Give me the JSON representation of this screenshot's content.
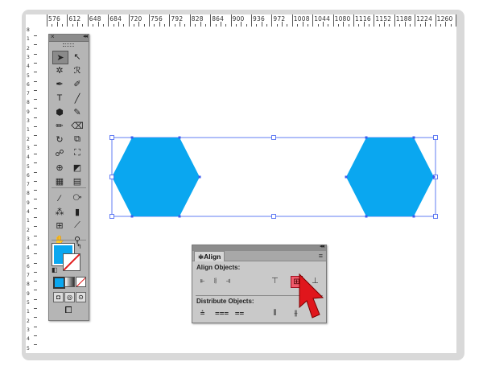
{
  "ruler": {
    "top_numbers": [
      "576",
      "612",
      "648",
      "684",
      "720",
      "756",
      "792",
      "828",
      "864",
      "900",
      "936",
      "972",
      "1008",
      "1044",
      "1080",
      "1116",
      "1152",
      "1188",
      "1224",
      "1260",
      "1"
    ],
    "left_numbers": [
      "8",
      "1",
      "2",
      "3",
      "4",
      "5",
      "6",
      "7",
      "8",
      "9",
      "3",
      "1",
      "2",
      "3",
      "4",
      "5",
      "6",
      "7",
      "8",
      "9",
      "4",
      "1",
      "2",
      "3",
      "4",
      "5",
      "6",
      "7",
      "8",
      "9",
      "5",
      "1",
      "2",
      "3",
      "4",
      "5"
    ]
  },
  "toolbar": {
    "close_glyph": "×",
    "collapse_glyph": "◂◂",
    "tools": [
      {
        "name": "selection-tool",
        "glyph": "➤",
        "selected": true
      },
      {
        "name": "direct-selection-tool",
        "glyph": "↖",
        "selected": false
      },
      {
        "name": "magic-wand-tool",
        "glyph": "✲",
        "selected": false
      },
      {
        "name": "lasso-tool",
        "glyph": "ℛ",
        "selected": false
      },
      {
        "name": "pen-tool",
        "glyph": "✒",
        "selected": false
      },
      {
        "name": "curvature-tool",
        "glyph": "✐",
        "selected": false
      },
      {
        "name": "type-tool",
        "glyph": "T",
        "selected": false
      },
      {
        "name": "line-tool",
        "glyph": "╱",
        "selected": false
      },
      {
        "name": "shape-tool",
        "glyph": "⬢",
        "selected": false
      },
      {
        "name": "paintbrush-tool",
        "glyph": "✎",
        "selected": false
      },
      {
        "name": "pencil-tool",
        "glyph": "✏",
        "selected": false
      },
      {
        "name": "eraser-tool",
        "glyph": "⌫",
        "selected": false
      },
      {
        "name": "rotate-tool",
        "glyph": "↻",
        "selected": false
      },
      {
        "name": "scale-tool",
        "glyph": "⧉",
        "selected": false
      },
      {
        "name": "warp-tool",
        "glyph": "☍",
        "selected": false
      },
      {
        "name": "free-transform-tool",
        "glyph": "⛶",
        "selected": false
      },
      {
        "name": "shape-builder-tool",
        "glyph": "⊕",
        "selected": false
      },
      {
        "name": "live-paint-tool",
        "glyph": "◩",
        "selected": false
      },
      {
        "name": "perspective-grid-tool",
        "glyph": "▦",
        "selected": false
      },
      {
        "name": "gradient-tool",
        "glyph": "▤",
        "selected": false
      },
      {
        "name": "eyedropper-tool",
        "glyph": "⁄",
        "selected": false
      },
      {
        "name": "blend-tool",
        "glyph": "⧂",
        "selected": false
      },
      {
        "name": "symbol-sprayer-tool",
        "glyph": "⁂",
        "selected": false
      },
      {
        "name": "graph-tool",
        "glyph": "▮",
        "selected": false
      },
      {
        "name": "artboard-tool",
        "glyph": "⊞",
        "selected": false
      },
      {
        "name": "slice-tool",
        "glyph": "⟋",
        "selected": false
      },
      {
        "name": "hand-tool",
        "glyph": "✋",
        "selected": false
      },
      {
        "name": "zoom-tool",
        "glyph": "⚲",
        "selected": false
      }
    ],
    "fill_color": "#0aa7f0",
    "swap_glyph": "↰",
    "default_glyph": "◧",
    "draw_mode_glyphs": [
      "◘",
      "◎",
      "⊙"
    ],
    "screen_mode_glyph": "⧠"
  },
  "align_panel": {
    "tab_label": "Align",
    "tab_prefix": "≑",
    "menu_glyph": "≡",
    "collapse_glyph": "◂◂",
    "align_objects_label": "Align Objects:",
    "distribute_objects_label": "Distribute Objects:",
    "align_buttons": [
      {
        "name": "horizontal-align-left",
        "glyph": "⫦"
      },
      {
        "name": "horizontal-align-center",
        "glyph": "⧛"
      },
      {
        "name": "horizontal-align-right",
        "glyph": "⫣"
      },
      {
        "name": "vertical-align-top",
        "glyph": "⊤"
      },
      {
        "name": "vertical-align-center",
        "glyph": "⊞"
      },
      {
        "name": "vertical-align-bottom",
        "glyph": "⊥"
      }
    ],
    "distribute_buttons": [
      {
        "name": "vertical-distribute-top",
        "glyph": "⩮"
      },
      {
        "name": "vertical-distribute-center",
        "glyph": "⩶"
      },
      {
        "name": "vertical-distribute-bottom",
        "glyph": "⩵"
      },
      {
        "name": "horizontal-distribute-left",
        "glyph": "⫴"
      },
      {
        "name": "horizontal-distribute-center",
        "glyph": "⫵"
      },
      {
        "name": "horizontal-distribute-right",
        "glyph": "⫼"
      }
    ],
    "highlighted_button": "vertical-align-center"
  },
  "artwork": {
    "shape_color": "#0aa7f0",
    "selection_color": "#3b5cf0",
    "pointer_color": "#e0161c"
  }
}
